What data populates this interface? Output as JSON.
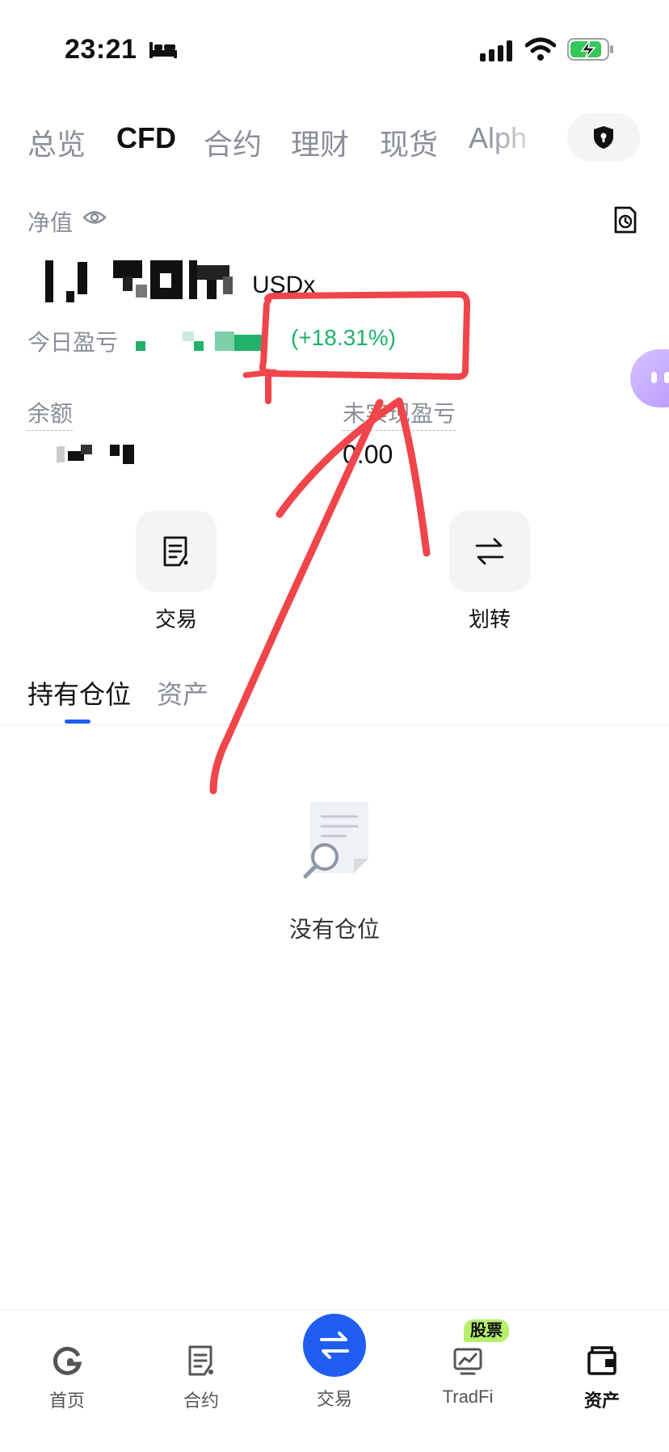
{
  "status_bar": {
    "time": "23:21"
  },
  "top_tabs": [
    {
      "label": "总览",
      "active": false
    },
    {
      "label": "CFD",
      "active": true
    },
    {
      "label": "合约",
      "active": false
    },
    {
      "label": "理财",
      "active": false
    },
    {
      "label": "现货",
      "active": false
    },
    {
      "label": "Alph",
      "active": false
    }
  ],
  "equity": {
    "label": "净值",
    "unit": "USDx"
  },
  "today_pnl": {
    "label": "今日盈亏",
    "percent": "(+18.31%)"
  },
  "balance": {
    "label": "余额"
  },
  "unrealized_pnl": {
    "label": "未实现盈亏",
    "value": "0.00"
  },
  "actions": {
    "trade": "交易",
    "transfer": "划转"
  },
  "sub_tabs": {
    "positions": "持有仓位",
    "assets": "资产"
  },
  "empty_state": {
    "text": "没有仓位"
  },
  "bottom_nav": {
    "home": "首页",
    "futures": "合约",
    "trade": "交易",
    "tradfi": "TradFi",
    "tradfi_badge": "股票",
    "assets": "资产"
  },
  "colors": {
    "accent": "#1f5ef0",
    "positive": "#20b26c",
    "annotation": "#f0454a"
  }
}
